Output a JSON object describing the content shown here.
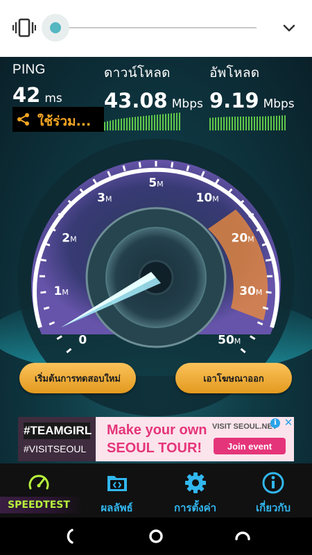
{
  "volume_panel": {
    "level": 0.0,
    "icons": [
      "vibrate-icon",
      "chevron-down-icon"
    ]
  },
  "stats": {
    "ping": {
      "label": "PING",
      "value": "42",
      "unit": "ms"
    },
    "download": {
      "label": "ดาวน์โหลด",
      "value": "43.08",
      "unit": "Mbps"
    },
    "upload": {
      "label": "อัพโหลด",
      "value": "9.19",
      "unit": "Mbps"
    }
  },
  "share": {
    "label": "ใช้ร่วม...",
    "icon": "share-icon"
  },
  "gauge": {
    "ticks": [
      {
        "num": "0",
        "unit": ""
      },
      {
        "num": "1",
        "unit": "M"
      },
      {
        "num": "2",
        "unit": "M"
      },
      {
        "num": "3",
        "unit": "M"
      },
      {
        "num": "5",
        "unit": "M"
      },
      {
        "num": "10",
        "unit": "M"
      },
      {
        "num": "20",
        "unit": "M"
      },
      {
        "num": "30",
        "unit": "M"
      },
      {
        "num": "50",
        "unit": "M"
      }
    ],
    "needle_value_fraction": 0.0,
    "colors": {
      "ring": "#ffffff",
      "accent_orange": "#f0883a",
      "accent_purple": "#a474e6",
      "needle": "#9df4ff"
    }
  },
  "buttons": {
    "start_new_test": "เริ่มต้นการทดสอบใหม่",
    "remove_ads": "เอาโฆษณาออก"
  },
  "ad": {
    "teamgirl": "#TEAMGIRL",
    "visitseoul": "#VISITSEOUL",
    "headline1": "Make your own",
    "headline2": "SEOUL TOUR!",
    "brand": "VISIT SEOUL.NET",
    "cta": "Join event",
    "info_glyph": "i",
    "close_glyph": "✕"
  },
  "tabs": [
    {
      "id": "speedtest",
      "label": "SPEEDTEST",
      "icon": "speedometer-icon",
      "active": true
    },
    {
      "id": "results",
      "label": "ผลลัพธ์",
      "icon": "folder-icon",
      "active": false
    },
    {
      "id": "settings",
      "label": "การตั้งค่า",
      "icon": "gear-icon",
      "active": false
    },
    {
      "id": "about",
      "label": "เกี่ยวกับ",
      "icon": "info-icon",
      "active": false
    }
  ],
  "colors": {
    "tab_blue": "#31b7ef",
    "tab_active": "#b8f23d",
    "share_orange": "#f5a623",
    "button_gold": "#f5b340",
    "bg_teal": "#0f3a44"
  }
}
